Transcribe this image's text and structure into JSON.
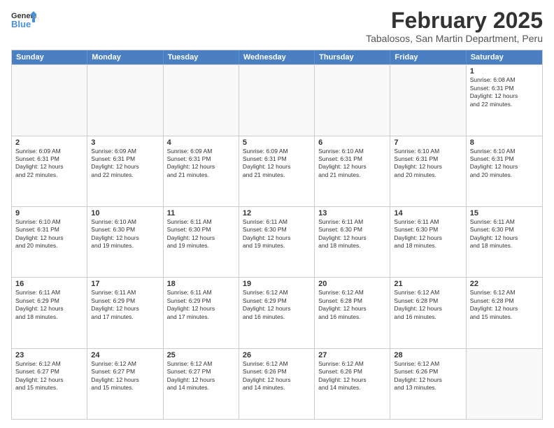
{
  "logo": {
    "line1": "General",
    "line2": "Blue"
  },
  "title": "February 2025",
  "subtitle": "Tabalosos, San Martin Department, Peru",
  "days": [
    "Sunday",
    "Monday",
    "Tuesday",
    "Wednesday",
    "Thursday",
    "Friday",
    "Saturday"
  ],
  "weeks": [
    [
      {
        "day": "",
        "info": ""
      },
      {
        "day": "",
        "info": ""
      },
      {
        "day": "",
        "info": ""
      },
      {
        "day": "",
        "info": ""
      },
      {
        "day": "",
        "info": ""
      },
      {
        "day": "",
        "info": ""
      },
      {
        "day": "1",
        "info": "Sunrise: 6:08 AM\nSunset: 6:31 PM\nDaylight: 12 hours\nand 22 minutes."
      }
    ],
    [
      {
        "day": "2",
        "info": "Sunrise: 6:09 AM\nSunset: 6:31 PM\nDaylight: 12 hours\nand 22 minutes."
      },
      {
        "day": "3",
        "info": "Sunrise: 6:09 AM\nSunset: 6:31 PM\nDaylight: 12 hours\nand 22 minutes."
      },
      {
        "day": "4",
        "info": "Sunrise: 6:09 AM\nSunset: 6:31 PM\nDaylight: 12 hours\nand 21 minutes."
      },
      {
        "day": "5",
        "info": "Sunrise: 6:09 AM\nSunset: 6:31 PM\nDaylight: 12 hours\nand 21 minutes."
      },
      {
        "day": "6",
        "info": "Sunrise: 6:10 AM\nSunset: 6:31 PM\nDaylight: 12 hours\nand 21 minutes."
      },
      {
        "day": "7",
        "info": "Sunrise: 6:10 AM\nSunset: 6:31 PM\nDaylight: 12 hours\nand 20 minutes."
      },
      {
        "day": "8",
        "info": "Sunrise: 6:10 AM\nSunset: 6:31 PM\nDaylight: 12 hours\nand 20 minutes."
      }
    ],
    [
      {
        "day": "9",
        "info": "Sunrise: 6:10 AM\nSunset: 6:31 PM\nDaylight: 12 hours\nand 20 minutes."
      },
      {
        "day": "10",
        "info": "Sunrise: 6:10 AM\nSunset: 6:30 PM\nDaylight: 12 hours\nand 19 minutes."
      },
      {
        "day": "11",
        "info": "Sunrise: 6:11 AM\nSunset: 6:30 PM\nDaylight: 12 hours\nand 19 minutes."
      },
      {
        "day": "12",
        "info": "Sunrise: 6:11 AM\nSunset: 6:30 PM\nDaylight: 12 hours\nand 19 minutes."
      },
      {
        "day": "13",
        "info": "Sunrise: 6:11 AM\nSunset: 6:30 PM\nDaylight: 12 hours\nand 18 minutes."
      },
      {
        "day": "14",
        "info": "Sunrise: 6:11 AM\nSunset: 6:30 PM\nDaylight: 12 hours\nand 18 minutes."
      },
      {
        "day": "15",
        "info": "Sunrise: 6:11 AM\nSunset: 6:30 PM\nDaylight: 12 hours\nand 18 minutes."
      }
    ],
    [
      {
        "day": "16",
        "info": "Sunrise: 6:11 AM\nSunset: 6:29 PM\nDaylight: 12 hours\nand 18 minutes."
      },
      {
        "day": "17",
        "info": "Sunrise: 6:11 AM\nSunset: 6:29 PM\nDaylight: 12 hours\nand 17 minutes."
      },
      {
        "day": "18",
        "info": "Sunrise: 6:11 AM\nSunset: 6:29 PM\nDaylight: 12 hours\nand 17 minutes."
      },
      {
        "day": "19",
        "info": "Sunrise: 6:12 AM\nSunset: 6:29 PM\nDaylight: 12 hours\nand 16 minutes."
      },
      {
        "day": "20",
        "info": "Sunrise: 6:12 AM\nSunset: 6:28 PM\nDaylight: 12 hours\nand 16 minutes."
      },
      {
        "day": "21",
        "info": "Sunrise: 6:12 AM\nSunset: 6:28 PM\nDaylight: 12 hours\nand 16 minutes."
      },
      {
        "day": "22",
        "info": "Sunrise: 6:12 AM\nSunset: 6:28 PM\nDaylight: 12 hours\nand 15 minutes."
      }
    ],
    [
      {
        "day": "23",
        "info": "Sunrise: 6:12 AM\nSunset: 6:27 PM\nDaylight: 12 hours\nand 15 minutes."
      },
      {
        "day": "24",
        "info": "Sunrise: 6:12 AM\nSunset: 6:27 PM\nDaylight: 12 hours\nand 15 minutes."
      },
      {
        "day": "25",
        "info": "Sunrise: 6:12 AM\nSunset: 6:27 PM\nDaylight: 12 hours\nand 14 minutes."
      },
      {
        "day": "26",
        "info": "Sunrise: 6:12 AM\nSunset: 6:26 PM\nDaylight: 12 hours\nand 14 minutes."
      },
      {
        "day": "27",
        "info": "Sunrise: 6:12 AM\nSunset: 6:26 PM\nDaylight: 12 hours\nand 14 minutes."
      },
      {
        "day": "28",
        "info": "Sunrise: 6:12 AM\nSunset: 6:26 PM\nDaylight: 12 hours\nand 13 minutes."
      },
      {
        "day": "",
        "info": ""
      }
    ]
  ]
}
